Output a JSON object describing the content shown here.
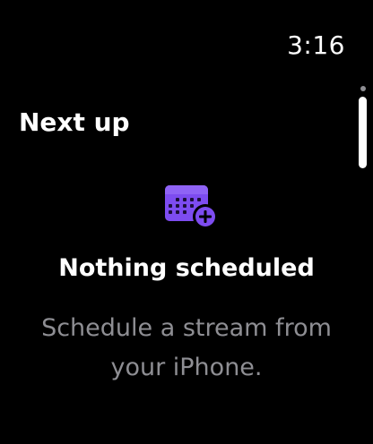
{
  "status_bar": {
    "time": "3:16"
  },
  "header": {
    "title": "Next up"
  },
  "empty_state": {
    "icon": "calendar-add-icon",
    "title": "Nothing scheduled",
    "subtitle": "Schedule a stream from your iPhone."
  },
  "colors": {
    "background": "#000000",
    "accent": "#7d4cf0",
    "secondary_text": "#8e8e93"
  }
}
